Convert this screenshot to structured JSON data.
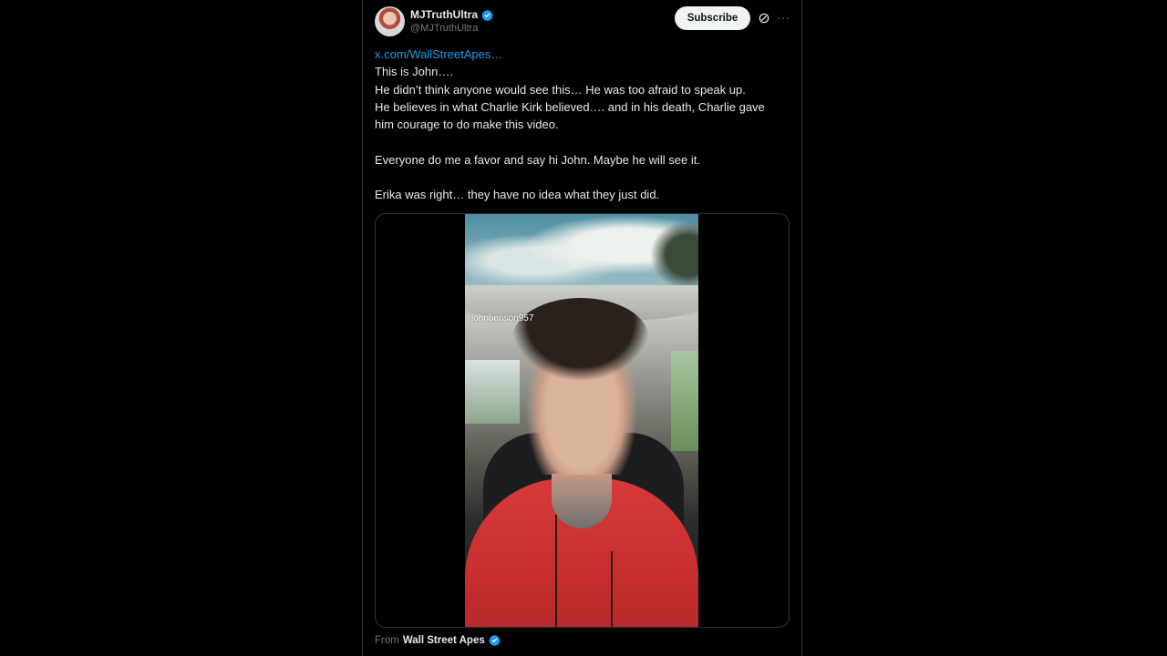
{
  "post": {
    "author": {
      "display_name": "MJTruthUltra",
      "handle": "@MJTruthUltra",
      "verified": true
    },
    "subscribe_label": "Subscribe",
    "link_text": "x.com/WallStreetApes…",
    "text_lines": [
      "This is John….",
      "He didn’t think anyone would see this… He was too afraid to speak up.",
      "He believes in what Charlie Kirk believed…. and in his death, Charlie gave",
      "him courage to do make this video.",
      "",
      "Everyone do me a favor and say hi John. Maybe he will see it.",
      "",
      "Erika was right… they have no idea what they just did."
    ],
    "video": {
      "watermark": "johnbenson957"
    },
    "attribution": {
      "prefix": "From",
      "source_name": "Wall Street Apes",
      "verified": true
    }
  },
  "colors": {
    "background": "#000000",
    "text": "#e7e9ea",
    "secondary_text": "#71767b",
    "link": "#1d9bf0",
    "verified_badge": "#1d9bf0",
    "border": "#2f3336",
    "subscribe_bg": "#eff3f4"
  },
  "icons": {
    "grok": "grok-icon",
    "more": "more-icon",
    "verified": "verified-badge-icon"
  }
}
